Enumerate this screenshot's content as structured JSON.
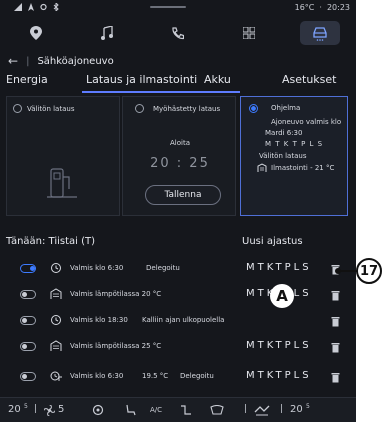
{
  "status": {
    "temperature": "16°C",
    "time": "20:23"
  },
  "header": {
    "title": "Sähköajoneuvo"
  },
  "tabs": [
    {
      "label": "Energia"
    },
    {
      "label": "Lataus ja ilmastointi"
    },
    {
      "label": "Akku"
    },
    {
      "label": "Asetukset"
    }
  ],
  "cards": {
    "immediate": {
      "title": "Välitön lataus"
    },
    "delayed": {
      "title": "Myöhästetty lataus",
      "start_label": "Aloita",
      "time": "20 : 25",
      "save": "Tallenna"
    },
    "program": {
      "title": "Ohjelma",
      "line1": "Ajoneuvo valmis klo",
      "line2": "Mardi    6:30",
      "line3": "M T K T P L S",
      "line4": "Välitön lataus",
      "line5": "Ilmastointi - 21 °C"
    }
  },
  "schedule": {
    "today_label": "Tänään: Tiistai (T)",
    "new_label": "Uusi ajastus",
    "rows": [
      {
        "on": true,
        "text": "Valmis klo 6:30",
        "extra1": "Delegoitu",
        "extra2": "",
        "days": "MTKTPLS"
      },
      {
        "on": false,
        "text": "Valmis lämpötilassa 20 °C",
        "extra1": "",
        "extra2": "",
        "days": "MTKTPLS"
      },
      {
        "on": false,
        "text": "Valmis klo 18:30",
        "extra1": "Kalliin ajan ulkopuolella",
        "extra2": "",
        "days": ""
      },
      {
        "on": false,
        "text": "Valmis lämpötilassa 25 °C",
        "extra1": "",
        "extra2": "",
        "days": "MTKTPLS"
      },
      {
        "on": false,
        "text": "Valmis klo 6:30",
        "extra1": "19.5 °C",
        "extra2": "Delegoitu",
        "days": "MTKTPLS"
      }
    ]
  },
  "bottombar": {
    "left_temp": "20",
    "fan": "5",
    "ac": "A/C",
    "right_temp": "20"
  },
  "callouts": {
    "marker": "A",
    "number": "17"
  },
  "colors": {
    "accent": "#3d7bff",
    "tab_underline": "#5e7cff",
    "background": "#15171c"
  }
}
